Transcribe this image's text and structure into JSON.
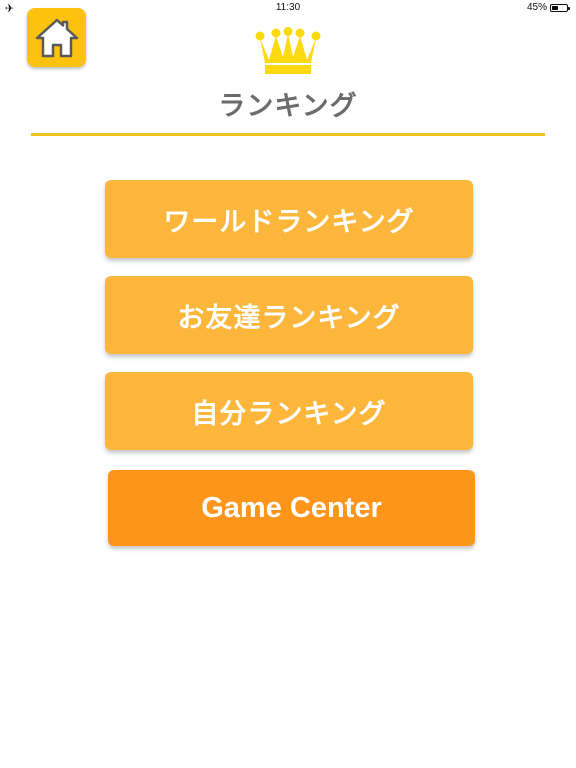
{
  "status_bar": {
    "airplane_icon": "airplane-icon",
    "time": "11:30",
    "battery_text": "45%",
    "battery_level": 0.45
  },
  "header": {
    "home_icon": "home-icon",
    "crown_icon": "crown-icon",
    "title": "ランキング"
  },
  "menu": {
    "world_ranking": "ワールドランキング",
    "friends_ranking": "お友達ランキング",
    "my_ranking": "自分ランキング",
    "game_center": "Game Center"
  },
  "colors": {
    "home_button": "#fcc20f",
    "crown": "#fcd80e",
    "title_text": "#6b6b6b",
    "underline": "#f2c31c",
    "ranking_button": "#fdb63c",
    "game_center_button": "#fd951b",
    "button_text": "#ffffff"
  }
}
